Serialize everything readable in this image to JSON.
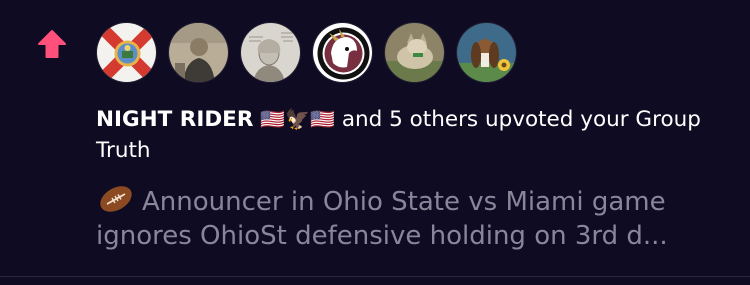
{
  "notification": {
    "icon": "upvote-arrow-icon",
    "accent_color": "#ff4f7b",
    "avatars": [
      {
        "name": "florida-seal-avatar"
      },
      {
        "name": "old-photo-avatar"
      },
      {
        "name": "franklin-sketch-avatar"
      },
      {
        "name": "fsu-logo-avatar"
      },
      {
        "name": "dog-avatar"
      },
      {
        "name": "basset-hound-avatar"
      }
    ],
    "actor_name": "NIGHT RIDER",
    "actor_emoji": "🇺🇸🦅🇺🇸",
    "message_rest": " and 5 others upvoted your Group Truth",
    "preview_emoji": "football-icon",
    "preview_line_1": "Announcer in Ohio State vs Miami game",
    "preview_line_2": "ignores OhioSt defensive holding on 3rd d..."
  }
}
